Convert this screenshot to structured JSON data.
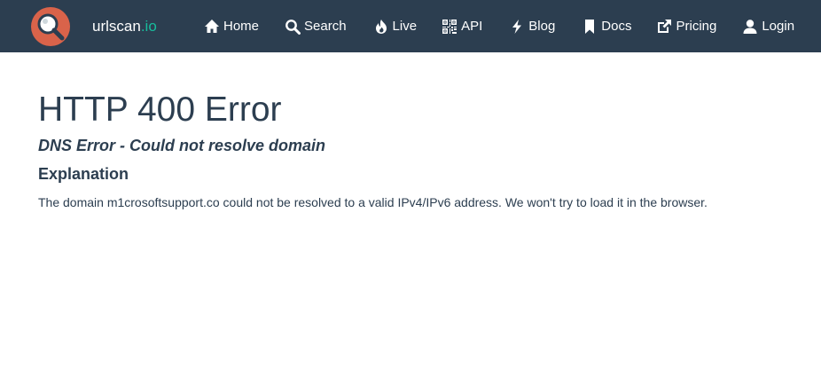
{
  "brand": {
    "name": "urlscan",
    "tld": ".io",
    "logo_icon": "magnifier-logo-icon"
  },
  "nav": {
    "items": [
      {
        "label": "Home",
        "icon": "home-icon"
      },
      {
        "label": "Search",
        "icon": "search-icon"
      },
      {
        "label": "Live",
        "icon": "fire-icon"
      },
      {
        "label": "API",
        "icon": "qrcode-icon"
      },
      {
        "label": "Blog",
        "icon": "flash-icon"
      },
      {
        "label": "Docs",
        "icon": "bookmark-icon"
      },
      {
        "label": "Pricing",
        "icon": "external-link-icon"
      },
      {
        "label": "Login",
        "icon": "user-icon"
      }
    ]
  },
  "main": {
    "title": "HTTP 400 Error",
    "subtitle": "DNS Error - Could not resolve domain",
    "section_heading": "Explanation",
    "explanation": "The domain m1crosoftsupport.co could not be resolved to a valid IPv4/IPv6 address. We won't try to load it in the browser."
  },
  "colors": {
    "navbar": "#2c3e50",
    "accent": "#18bc9c",
    "logo": "#d9634a",
    "text": "#2c3e50"
  }
}
